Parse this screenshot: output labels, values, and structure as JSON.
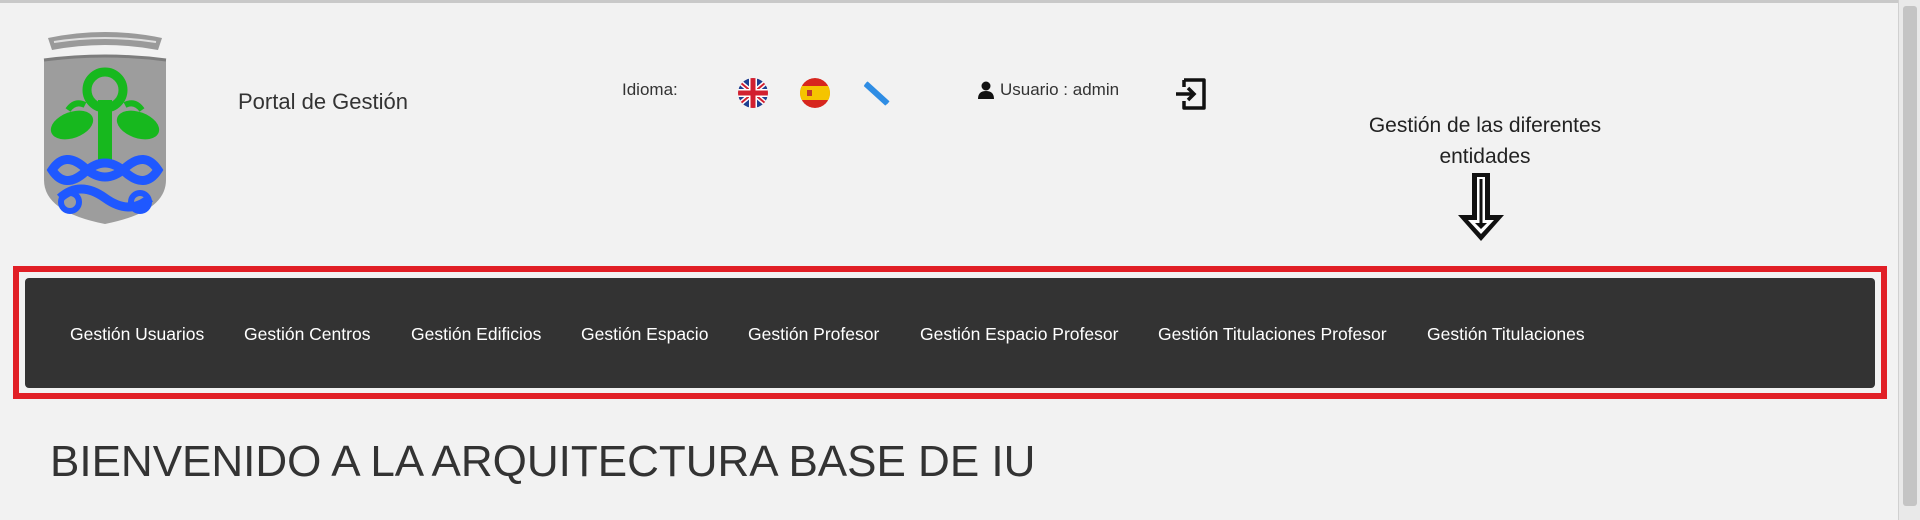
{
  "header": {
    "portal_title": "Portal de Gestión",
    "language_label": "Idioma:",
    "languages": [
      "english-flag",
      "spanish-flag",
      "galician-flag"
    ],
    "user_label": "Usuario : admin"
  },
  "annotation": {
    "text": "Gestión de las diferentes entidades"
  },
  "nav": {
    "items": [
      "Gestión Usuarios",
      "Gestión Centros",
      "Gestión Edificios",
      "Gestión Espacio",
      "Gestión Profesor",
      "Gestión Espacio Profesor",
      "Gestión Titulaciones Profesor",
      "Gestión Titulaciones"
    ]
  },
  "main": {
    "welcome_title": "BIENVENIDO A LA ARQUITECTURA BASE DE IU"
  },
  "colors": {
    "navbar_bg": "#333333",
    "highlight_border": "#e11f26",
    "page_bg": "#f2f2f2"
  }
}
